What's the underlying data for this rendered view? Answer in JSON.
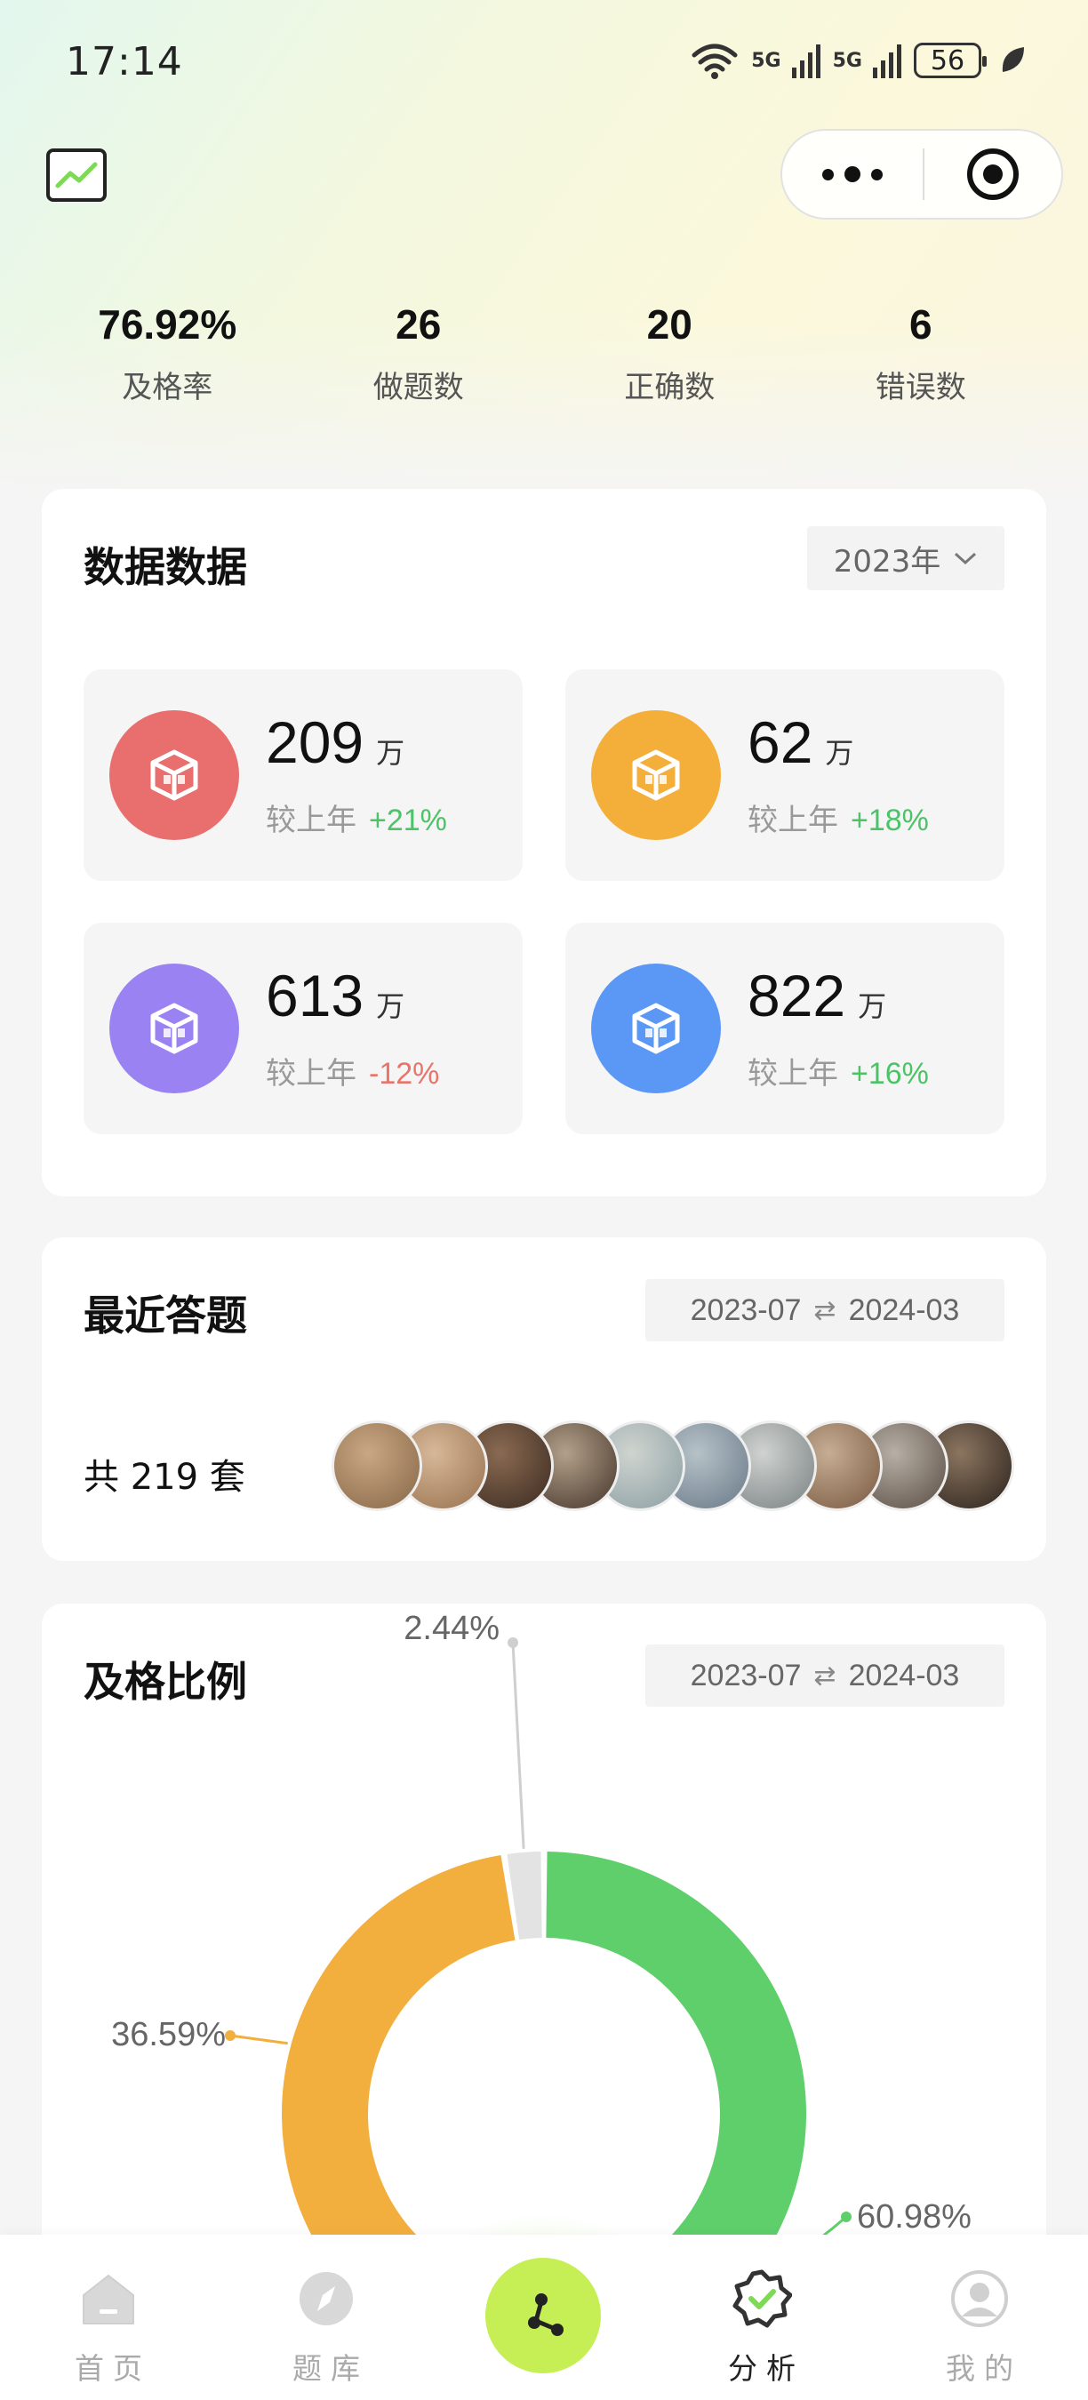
{
  "status_bar": {
    "time": "17:14",
    "battery": "56",
    "signal_1": "5G",
    "signal_2": "5G",
    "wifi_tag": "6"
  },
  "header": {
    "chart_icon": "trend-chart-icon",
    "more_icon": "more-dots-icon",
    "close_icon": "target-circle-icon"
  },
  "summary": [
    {
      "value": "76.92%",
      "label": "及格率"
    },
    {
      "value": "26",
      "label": "做题数"
    },
    {
      "value": "20",
      "label": "正确数"
    },
    {
      "value": "6",
      "label": "错误数"
    }
  ],
  "data_card": {
    "title": "数据数据",
    "year": "2023年",
    "compare_label": "较上年",
    "tiles": [
      {
        "value": "209",
        "unit": "万",
        "change": "+21%",
        "trend": "up",
        "color": "#e96f6f",
        "icon": "cube-icon"
      },
      {
        "value": "62",
        "unit": "万",
        "change": "+18%",
        "trend": "up",
        "color": "#f4ae3a",
        "icon": "cube-icon"
      },
      {
        "value": "613",
        "unit": "万",
        "change": "-12%",
        "trend": "down",
        "color": "#9b82f3",
        "icon": "cube-icon"
      },
      {
        "value": "822",
        "unit": "万",
        "change": "+16%",
        "trend": "up",
        "color": "#5b98f5",
        "icon": "cube-icon"
      }
    ]
  },
  "recent_card": {
    "title": "最近答题",
    "range_start": "2023-07",
    "range_end": "2024-03",
    "total": "共 219 套",
    "avatar_count": 10
  },
  "pass_card": {
    "title": "及格比例",
    "range_start": "2023-07",
    "range_end": "2024-03"
  },
  "chart_data": {
    "type": "pie",
    "style": "donut",
    "categories": [
      "绿色",
      "橙色",
      "灰色"
    ],
    "values": [
      60.98,
      36.59,
      2.44
    ],
    "labels": [
      "60.98%",
      "36.59%",
      "2.44%"
    ],
    "colors": [
      "#5ecf6a",
      "#f3af3d",
      "#e3e3e3"
    ]
  },
  "tabbar": {
    "tabs": [
      {
        "label": "首页",
        "icon": "home-icon",
        "active": false
      },
      {
        "label": "题库",
        "icon": "compass-icon",
        "active": false
      },
      {
        "label": "分析",
        "icon": "badge-check-icon",
        "active": true
      },
      {
        "label": "我的",
        "icon": "user-icon",
        "active": false
      }
    ],
    "center_icon": "share-nodes-icon"
  }
}
